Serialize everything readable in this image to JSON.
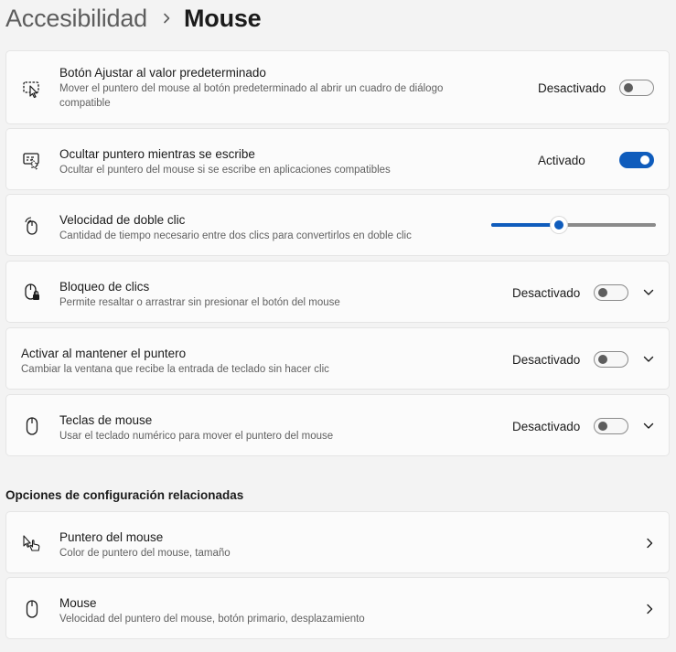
{
  "breadcrumb": {
    "parent": "Accesibilidad",
    "current": "Mouse"
  },
  "settings": [
    {
      "title": "Botón Ajustar al valor predeterminado",
      "desc_line1": "Mover el puntero del mouse al botón predeterminado al abrir un cuadro de diálogo",
      "desc_line2": "compatible",
      "state": "Desactivado",
      "on": false
    },
    {
      "title": "Ocultar puntero mientras se escribe",
      "desc": "Ocultar el puntero del mouse si se escribe en aplicaciones compatibles",
      "state": "Activado",
      "on": true
    },
    {
      "title": "Velocidad de doble clic",
      "desc": "Cantidad de tiempo necesario entre dos clics para convertirlos en doble clic",
      "slider_fraction": 0.41
    },
    {
      "title": "Bloqueo de clics",
      "desc": "Permite resaltar o arrastrar sin presionar el botón del mouse",
      "state": "Desactivado",
      "on": false
    },
    {
      "title": "Activar al mantener el puntero",
      "desc": "Cambiar la ventana que recibe la entrada de teclado sin hacer clic",
      "state": "Desactivado",
      "on": false
    },
    {
      "title": "Teclas de mouse",
      "desc": "Usar el teclado numérico para mover el puntero del mouse",
      "state": "Desactivado",
      "on": false
    }
  ],
  "related": {
    "heading": "Opciones de configuración relacionadas",
    "items": [
      {
        "title": "Puntero del mouse",
        "desc": "Color de puntero del mouse, tamaño"
      },
      {
        "title": "Mouse",
        "desc": "Velocidad del puntero del mouse, botón primario, desplazamiento"
      }
    ]
  },
  "icons": {
    "snap": "cursor-snap-icon",
    "hide": "hidden-pointer-icon",
    "dbl": "double-click-mouse-icon",
    "lock": "click-lock-mouse-icon",
    "mousekeys": "mouse-icon",
    "pointer": "pointer-hand-icon",
    "mouse": "mouse-icon"
  },
  "colors": {
    "accent": "#0f5cbc",
    "background": "#f3f3f3",
    "card": "#fbfbfb"
  }
}
